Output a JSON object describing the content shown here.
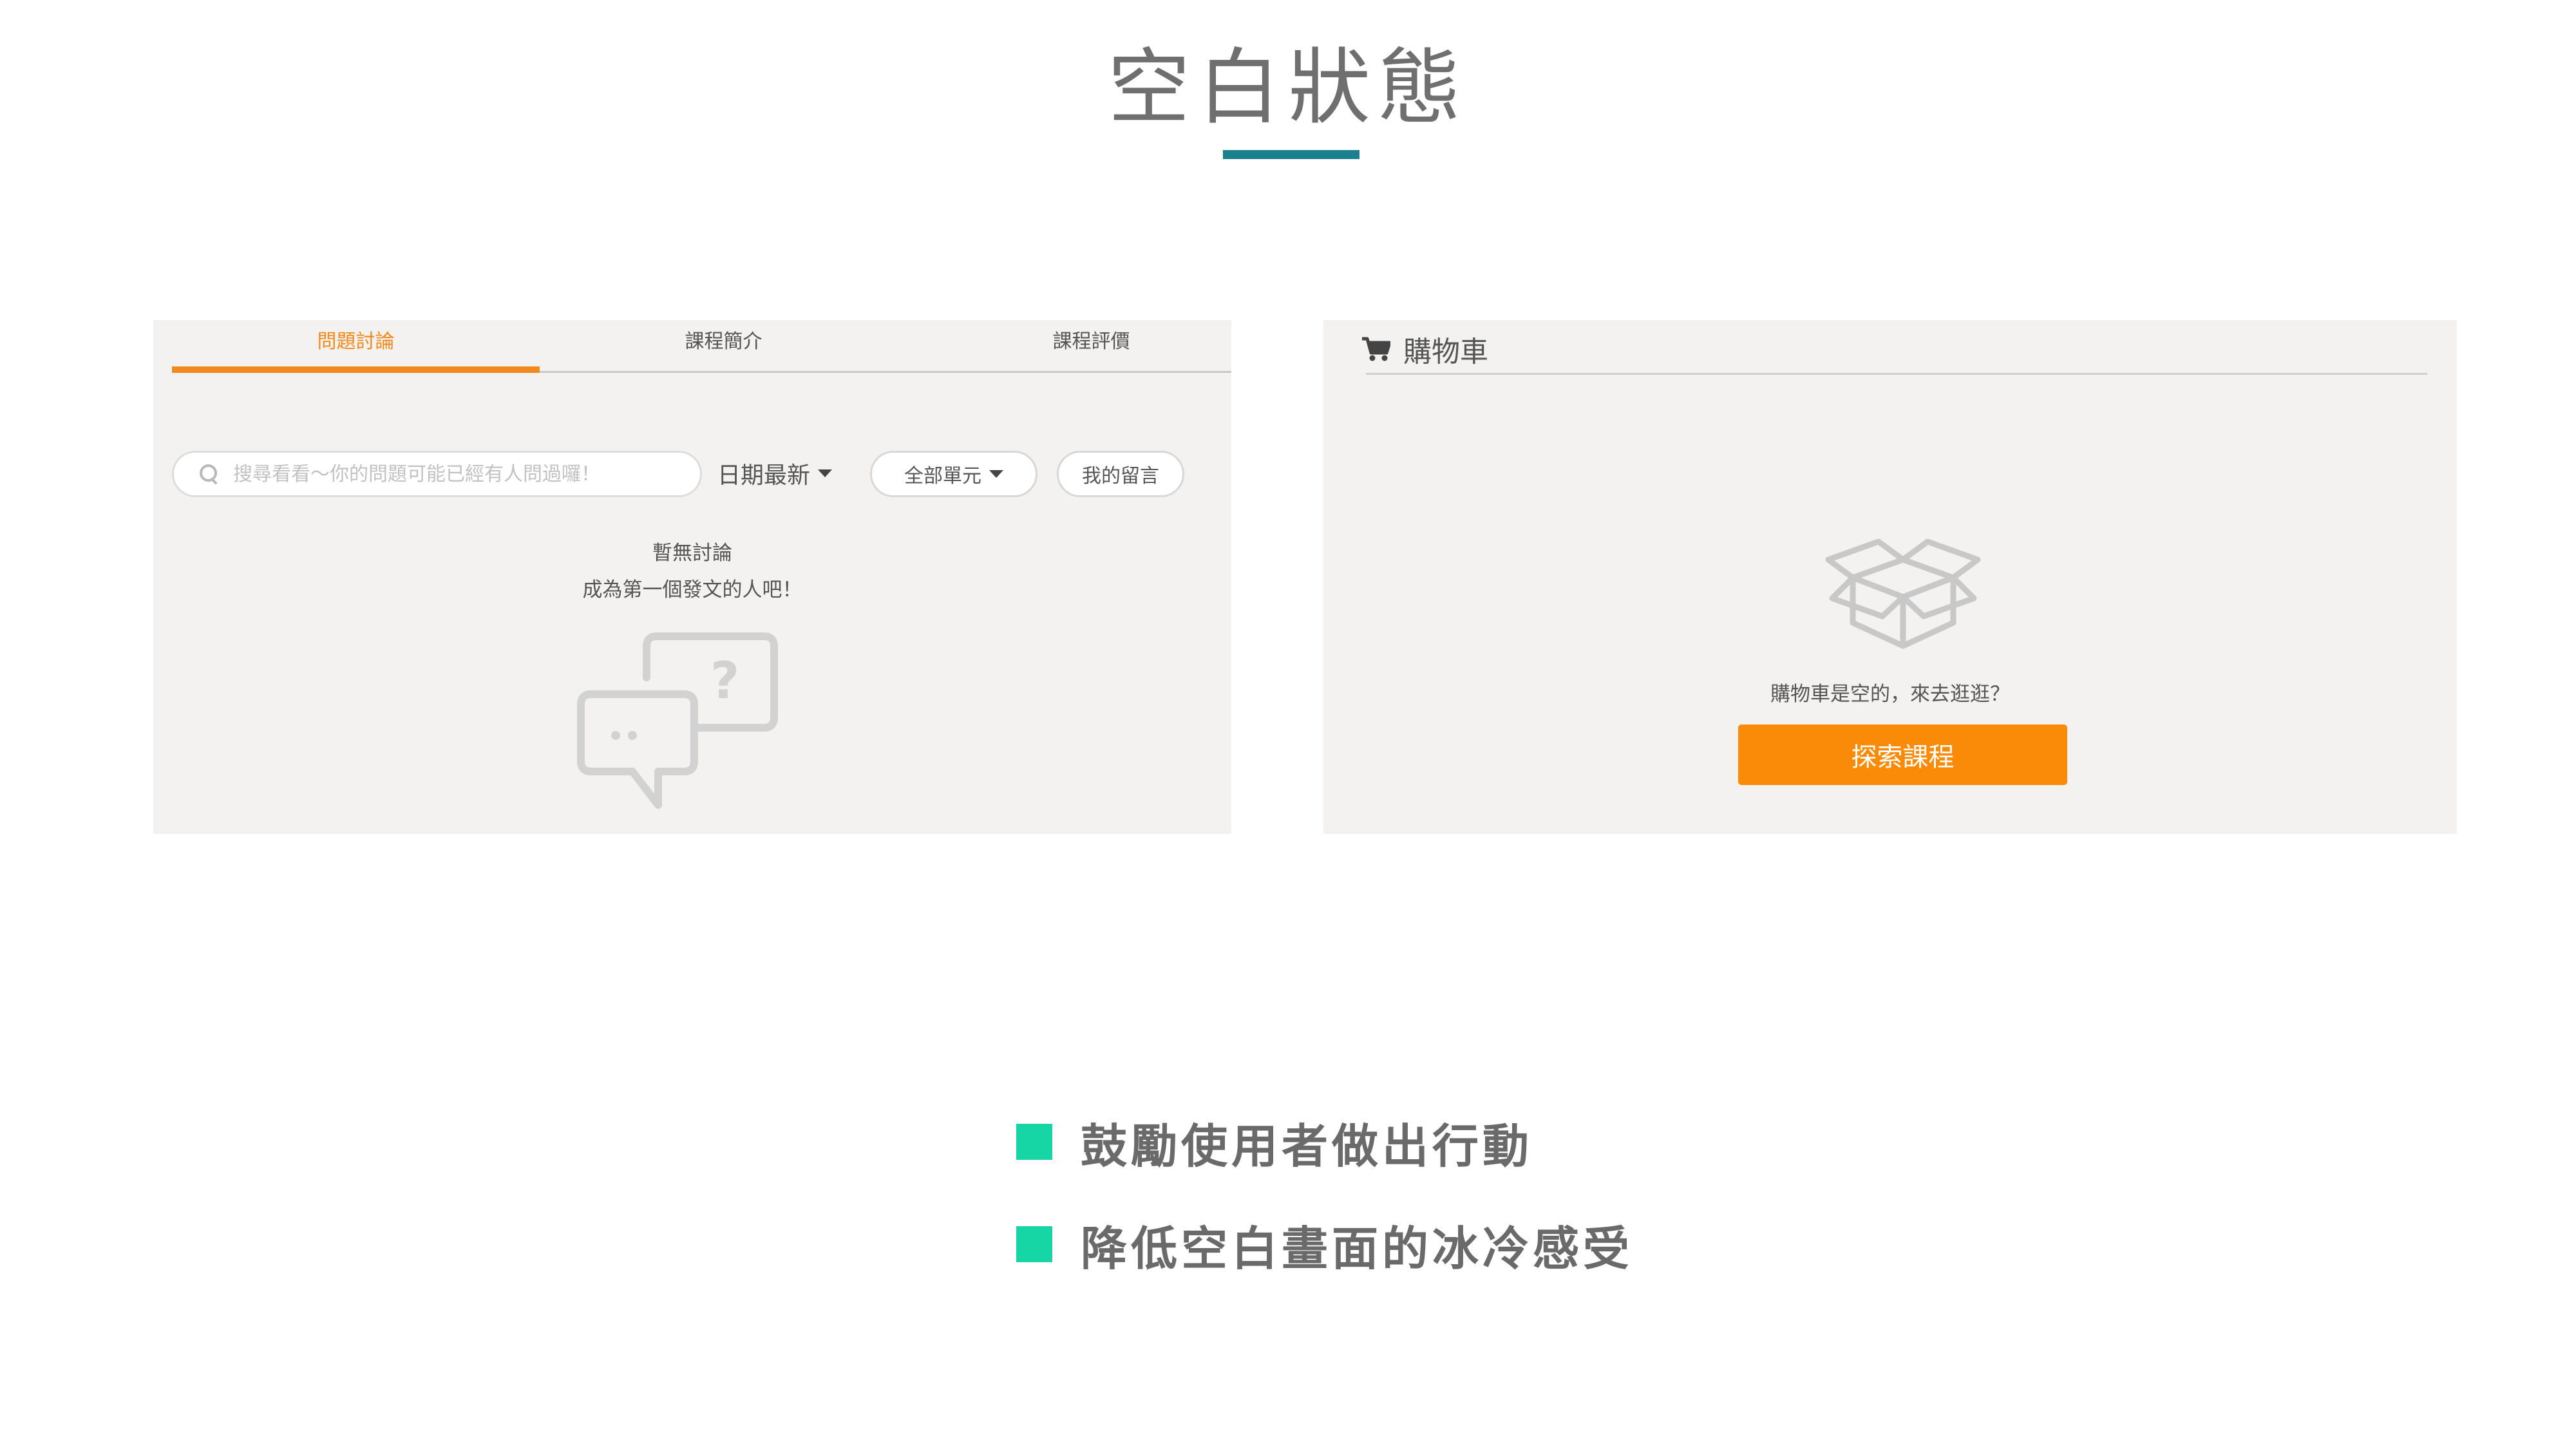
{
  "page": {
    "title": "空白狀態",
    "accent_color": "#1a7f8e"
  },
  "discussion_panel": {
    "tabs": [
      {
        "label": "問題討論",
        "active": true
      },
      {
        "label": "課程簡介",
        "active": false
      },
      {
        "label": "課程評價",
        "active": false
      }
    ],
    "search": {
      "placeholder": "搜尋看看～你的問題可能已經有人問過囉！",
      "value": ""
    },
    "sort_label": "日期最新",
    "unit_filter_label": "全部單元",
    "my_comments_label": "我的留言",
    "empty_title": "暫無討論",
    "empty_subtitle": "成為第一個發文的人吧！",
    "illustration_icon": "chat-question-icon",
    "active_color": "#f18a1c"
  },
  "cart_panel": {
    "title": "購物車",
    "icon": "shopping-cart-icon",
    "illustration_icon": "open-box-icon",
    "empty_text": "購物車是空的，來去逛逛？",
    "explore_button_label": "探索課程",
    "button_color": "#f98b09"
  },
  "bullets": [
    {
      "text": "鼓勵使用者做出行動"
    },
    {
      "text": "降低空白畫面的冰冷感受"
    }
  ],
  "bullet_color": "#16d6a5"
}
